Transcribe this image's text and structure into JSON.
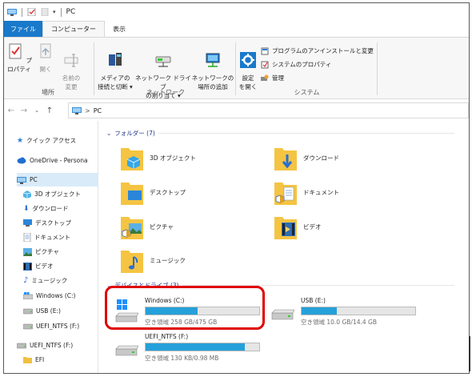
{
  "window": {
    "title": "PC"
  },
  "tabs": [
    "ファイル",
    "コンピューター",
    "表示"
  ],
  "ribbon": {
    "groups": [
      {
        "label": "場所",
        "buttons": [
          {
            "label": "プロパティ",
            "icon": "properties-icon"
          },
          {
            "label": "開く",
            "icon": "open-icon",
            "disabled": true
          },
          {
            "label": "名前の\n変更",
            "icon": "rename-icon",
            "disabled": true
          }
        ]
      },
      {
        "label": "ネットワーク",
        "buttons": [
          {
            "label": "メディアの\n接続と切断 ▾",
            "icon": "media-icon"
          },
          {
            "label": "ネットワーク ドライブ\nの割り当て ▾",
            "icon": "network-drive-icon"
          },
          {
            "label": "ネットワークの\n場所の追加",
            "icon": "network-location-icon"
          }
        ]
      },
      {
        "label": "システム",
        "buttons": [
          {
            "label": "設定\nを開く",
            "icon": "settings-icon"
          }
        ],
        "small_commands": [
          {
            "label": "プログラムのアンインストールと変更",
            "icon": "uninstall-icon"
          },
          {
            "label": "システムのプロパティ",
            "icon": "system-properties-icon"
          },
          {
            "label": "管理",
            "icon": "manage-icon"
          }
        ]
      }
    ]
  },
  "address": {
    "path": "PC",
    "separator": ">"
  },
  "nav_pane": [
    {
      "label": "クイック アクセス",
      "icon": "star-icon"
    },
    {
      "label": "OneDrive - Persona",
      "icon": "cloud-icon"
    },
    {
      "label": "PC",
      "icon": "pc-icon",
      "selected": true
    },
    {
      "label": "3D オブジェクト",
      "icon": "3d-objects-icon"
    },
    {
      "label": "ダウンロード",
      "icon": "download-icon"
    },
    {
      "label": "デスクトップ",
      "icon": "desktop-icon"
    },
    {
      "label": "ドキュメント",
      "icon": "documents-icon"
    },
    {
      "label": "ピクチャ",
      "icon": "pictures-icon"
    },
    {
      "label": "ビデオ",
      "icon": "videos-icon"
    },
    {
      "label": "ミュージック",
      "icon": "music-icon"
    },
    {
      "label": "Windows (C:)",
      "icon": "windows-drive-icon"
    },
    {
      "label": "USB (E:)",
      "icon": "usb-drive-icon"
    },
    {
      "label": "UEFI_NTFS (F:)",
      "icon": "drive-icon"
    },
    {
      "label": "UEFI_NTFS (F:)",
      "icon": "drive-icon"
    },
    {
      "label": "EFI",
      "icon": "folder-icon"
    }
  ],
  "folders_section": {
    "header": "フォルダー (7)",
    "items": [
      {
        "label": "3D オブジェクト",
        "icon": "3d-objects-icon"
      },
      {
        "label": "ダウンロード",
        "icon": "download-icon"
      },
      {
        "label": "デスクトップ",
        "icon": "desktop-icon"
      },
      {
        "label": "ドキュメント",
        "icon": "documents-icon"
      },
      {
        "label": "ピクチャ",
        "icon": "pictures-icon"
      },
      {
        "label": "ビデオ",
        "icon": "videos-icon"
      },
      {
        "label": "ミュージック",
        "icon": "music-icon"
      }
    ]
  },
  "drives_section": {
    "header": "デバイスとドライブ (3)",
    "items": [
      {
        "label": "Windows (C:)",
        "space": "空き領域 258 GB/475 GB",
        "used_fraction": 0.46,
        "icon": "windows-drive-icon"
      },
      {
        "label": "USB (E:)",
        "space": "空き領域 10.0 GB/14.4 GB",
        "used_fraction": 0.31,
        "icon": "usb-drive-icon"
      },
      {
        "label": "UEFI_NTFS (F:)",
        "space": "空き領域 130 KB/0.98 MB",
        "used_fraction": 0.87,
        "icon": "drive-icon"
      }
    ]
  },
  "colors": {
    "accent": "#1979ca",
    "bar_fill": "#26a0da",
    "highlight": "#e00000",
    "group_header": "#1e3287",
    "selected": "#d9ebf9"
  }
}
